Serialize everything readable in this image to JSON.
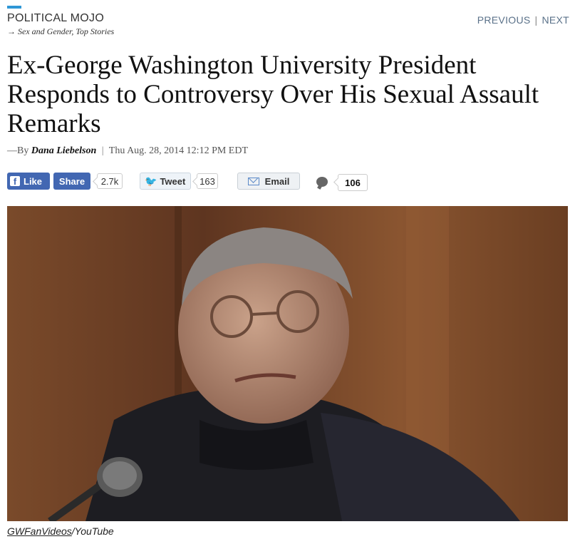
{
  "header": {
    "section": "POLITICAL MOJO",
    "tags_arrow": "→",
    "tag_1": "Sex and Gender",
    "tag_separator": ", ",
    "tag_2": "Top Stories"
  },
  "pager": {
    "previous": "PREVIOUS",
    "separator": "|",
    "next": "NEXT"
  },
  "article": {
    "headline": "Ex-George Washington University President Responds to Controversy Over His Sexual Assault Remarks",
    "byline_prefix": "—By",
    "author": "Dana Liebelson",
    "byline_separator": "|",
    "date": "Thu Aug. 28, 2014 12:12 PM EDT"
  },
  "share": {
    "facebook_like_label": "Like",
    "facebook_icon_glyph": "f",
    "facebook_share_label": "Share",
    "facebook_count": "2.7k",
    "tweet_label": "Tweet",
    "twitter_icon_glyph": "🐦",
    "tweet_count": "163",
    "email_label": "Email",
    "comment_count": "106",
    "facebook_color": "#4267b2",
    "twitter_color": "#1da1f2"
  },
  "image": {
    "caption_source": "GWFanVideos",
    "caption_rest": "/YouTube"
  },
  "colors": {
    "accent": "#2f97d6",
    "pager_link": "#5a7189",
    "photo_background": "#6a4024"
  },
  "icons": [
    "facebook-icon",
    "twitter-bird-icon",
    "email-envelope-icon",
    "comment-bubble-icon",
    "microphone"
  ]
}
